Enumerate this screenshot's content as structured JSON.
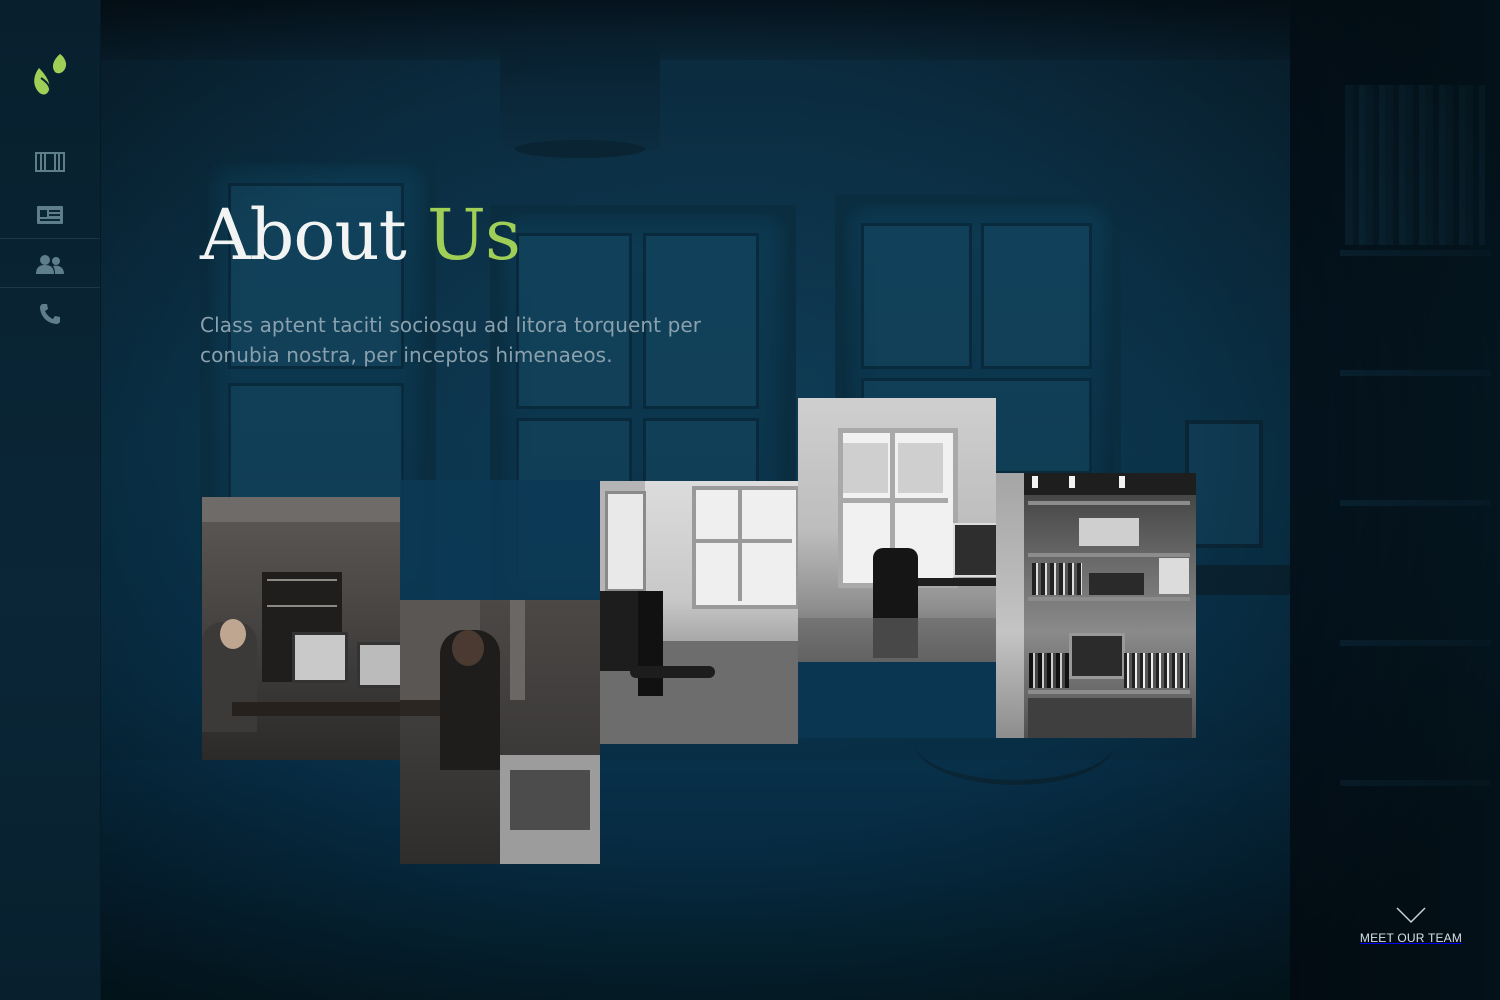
{
  "page": {
    "title_main": "About",
    "title_accent": "Us",
    "lead": "Class aptent taciti sociosqu ad litora torquent per conubia nostra, per inceptos himenaeos.",
    "cta_label": "MEET OUR TEAM"
  },
  "sidebar": {
    "logo": "leaf-drops-logo",
    "items": [
      {
        "icon": "film-strip-icon"
      },
      {
        "icon": "id-card-icon"
      },
      {
        "icon": "people-icon"
      },
      {
        "icon": "phone-icon"
      }
    ]
  },
  "colors": {
    "accent": "#9fcf57",
    "background": "#0a3147",
    "title": "#f2f4f3",
    "lead": "#8aa0ac"
  }
}
